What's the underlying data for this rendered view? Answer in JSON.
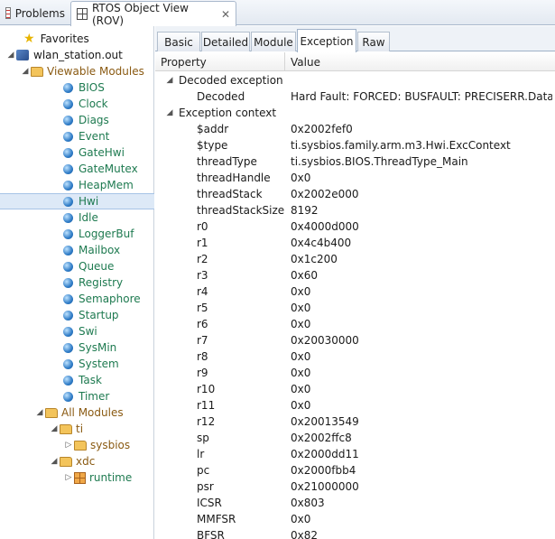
{
  "view_tabs": {
    "problems": "Problems",
    "rov": "RTOS Object View (ROV)",
    "close": "✕"
  },
  "tree": {
    "favorites": "Favorites",
    "target": "wlan_station.out",
    "viewable_modules": "Viewable Modules",
    "modules": [
      "BIOS",
      "Clock",
      "Diags",
      "Event",
      "GateHwi",
      "GateMutex",
      "HeapMem",
      "Hwi",
      "Idle",
      "LoggerBuf",
      "Mailbox",
      "Queue",
      "Registry",
      "Semaphore",
      "Startup",
      "Swi",
      "SysMin",
      "System",
      "Task",
      "Timer"
    ],
    "selected_module": "Hwi",
    "all_modules": "All Modules",
    "ti": "ti",
    "sysbios": "sysbios",
    "xdc": "xdc",
    "runtime": "runtime"
  },
  "subtabs": [
    "Basic",
    "Detailed",
    "Module",
    "Exception",
    "Raw"
  ],
  "active_subtab": "Exception",
  "table": {
    "headers": {
      "property": "Property",
      "value": "Value"
    },
    "groups": [
      {
        "name": "Decoded exception",
        "rows": [
          {
            "property": "Decoded",
            "value": "Hard Fault: FORCED: BUSFAULT: PRECISERR.Data ..."
          }
        ]
      },
      {
        "name": "Exception context",
        "rows": [
          {
            "property": "$addr",
            "value": "0x2002fef0"
          },
          {
            "property": "$type",
            "value": "ti.sysbios.family.arm.m3.Hwi.ExcContext"
          },
          {
            "property": "threadType",
            "value": "ti.sysbios.BIOS.ThreadType_Main"
          },
          {
            "property": "threadHandle",
            "value": "0x0"
          },
          {
            "property": "threadStack",
            "value": "0x2002e000"
          },
          {
            "property": "threadStackSize",
            "value": "8192"
          },
          {
            "property": "r0",
            "value": "0x4000d000"
          },
          {
            "property": "r1",
            "value": "0x4c4b400"
          },
          {
            "property": "r2",
            "value": "0x1c200"
          },
          {
            "property": "r3",
            "value": "0x60"
          },
          {
            "property": "r4",
            "value": "0x0"
          },
          {
            "property": "r5",
            "value": "0x0"
          },
          {
            "property": "r6",
            "value": "0x0"
          },
          {
            "property": "r7",
            "value": "0x20030000"
          },
          {
            "property": "r8",
            "value": "0x0"
          },
          {
            "property": "r9",
            "value": "0x0"
          },
          {
            "property": "r10",
            "value": "0x0"
          },
          {
            "property": "r11",
            "value": "0x0"
          },
          {
            "property": "r12",
            "value": "0x20013549"
          },
          {
            "property": "sp",
            "value": "0x2002ffc8"
          },
          {
            "property": "lr",
            "value": "0x2000dd11"
          },
          {
            "property": "pc",
            "value": "0x2000fbb4"
          },
          {
            "property": "psr",
            "value": "0x21000000"
          },
          {
            "property": "ICSR",
            "value": "0x803"
          },
          {
            "property": "MMFSR",
            "value": "0x0"
          },
          {
            "property": "BFSR",
            "value": "0x82"
          }
        ]
      }
    ]
  },
  "icons": {
    "expanded": "◢",
    "collapsed": "▷",
    "star": "★"
  }
}
